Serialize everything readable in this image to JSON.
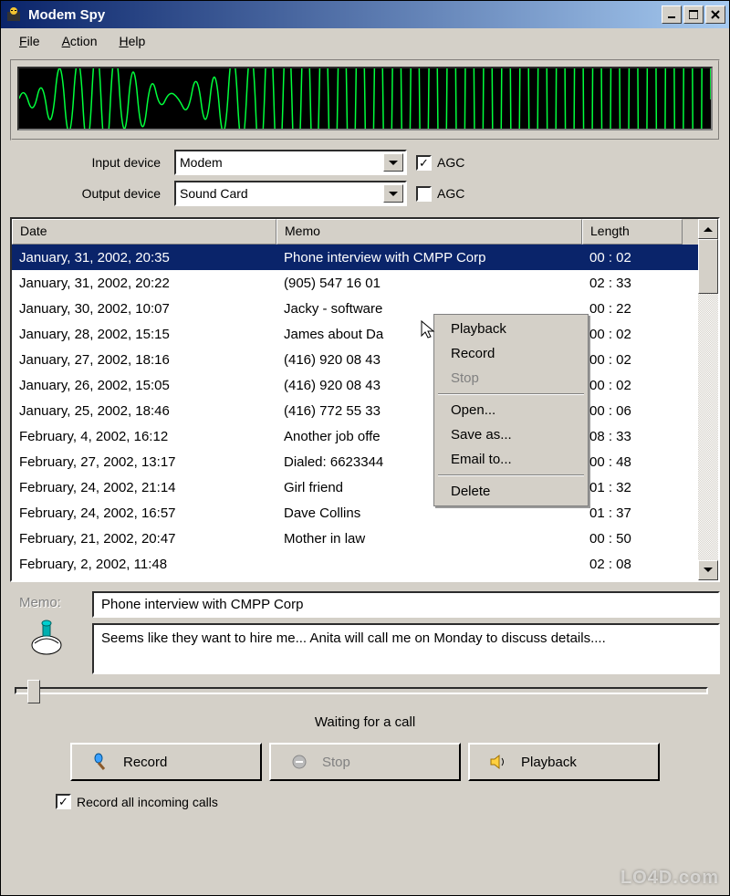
{
  "window": {
    "title": "Modem Spy"
  },
  "menubar": {
    "file": "File",
    "action": "Action",
    "help": "Help"
  },
  "devices": {
    "input_label": "Input device",
    "input_value": "Modem",
    "output_label": "Output device",
    "output_value": "Sound Card",
    "agc_label": "AGC",
    "input_agc_checked": true,
    "output_agc_checked": false
  },
  "columns": {
    "date": "Date",
    "memo": "Memo",
    "length": "Length"
  },
  "rows": [
    {
      "date": "January, 31, 2002, 20:35",
      "memo": "Phone interview with CMPP Corp",
      "length": "00 : 02",
      "selected": true
    },
    {
      "date": "January, 31, 2002, 20:22",
      "memo": "(905) 547 16 01",
      "length": "02 : 33"
    },
    {
      "date": "January, 30, 2002, 10:07",
      "memo": "Jacky - software",
      "length": "00 : 22"
    },
    {
      "date": "January, 28, 2002, 15:15",
      "memo": "James about Da",
      "length": "00 : 02"
    },
    {
      "date": "January, 27, 2002, 18:16",
      "memo": "(416) 920 08 43",
      "length": "00 : 02"
    },
    {
      "date": "January, 26, 2002, 15:05",
      "memo": "(416) 920 08 43",
      "length": "00 : 02"
    },
    {
      "date": "January, 25, 2002, 18:46",
      "memo": "(416) 772 55 33",
      "length": "00 : 06"
    },
    {
      "date": "February, 4, 2002, 16:12",
      "memo": "Another job offe",
      "length": "08 : 33"
    },
    {
      "date": "February, 27, 2002, 13:17",
      "memo": "Dialed: 6623344",
      "length": "00 : 48"
    },
    {
      "date": "February, 24, 2002, 21:14",
      "memo": "Girl friend",
      "length": "01 : 32"
    },
    {
      "date": "February, 24, 2002, 16:57",
      "memo": "Dave Collins",
      "length": "01 : 37"
    },
    {
      "date": "February, 21, 2002, 20:47",
      "memo": "Mother in law",
      "length": "00 : 50"
    },
    {
      "date": "February, 2, 2002, 11:48",
      "memo": "",
      "length": "02 : 08"
    }
  ],
  "context_menu": {
    "playback": "Playback",
    "record": "Record",
    "stop": "Stop",
    "open": "Open...",
    "save_as": "Save as...",
    "email_to": "Email to...",
    "delete": "Delete"
  },
  "memo": {
    "label": "Memo:",
    "title_value": "Phone interview with CMPP Corp",
    "details_value": "Seems like they want to hire me... Anita will call me on Monday to discuss details...."
  },
  "status": "Waiting for a call",
  "buttons": {
    "record": "Record",
    "stop": "Stop",
    "playback": "Playback"
  },
  "record_all": {
    "label": "Record all incoming calls",
    "checked": true
  },
  "watermark": "LO4D.com"
}
